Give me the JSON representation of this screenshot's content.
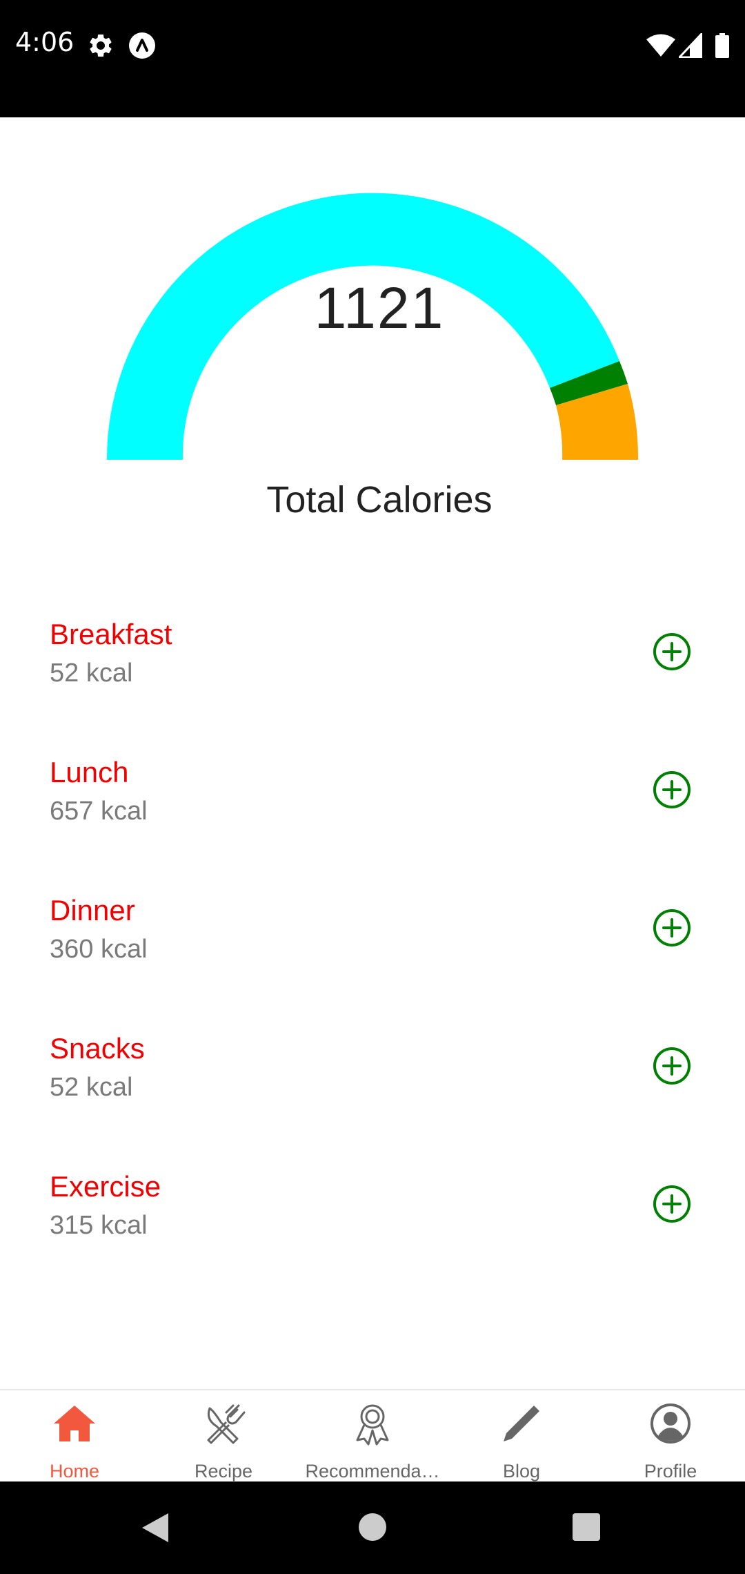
{
  "status_bar": {
    "time": "4:06",
    "icons": [
      "settings-icon",
      "app-notification-icon",
      "wifi-icon",
      "signal-icon",
      "battery-icon"
    ]
  },
  "gauge": {
    "value": "1121",
    "label": "Total Calories",
    "colors": {
      "main": "#00ffff",
      "secondary": "#008000",
      "tertiary": "#ffa500"
    }
  },
  "meals": [
    {
      "name": "Breakfast",
      "kcal": "52 kcal"
    },
    {
      "name": "Lunch",
      "kcal": "657 kcal"
    },
    {
      "name": "Dinner",
      "kcal": "360 kcal"
    },
    {
      "name": "Snacks",
      "kcal": "52 kcal"
    },
    {
      "name": "Exercise",
      "kcal": "315 kcal"
    }
  ],
  "colors": {
    "meal_name": "#f00000",
    "meal_kcal": "#7a7a7a",
    "add_button": "#008000",
    "nav_active": "#f2583e",
    "nav_inactive": "#666666"
  },
  "nav": {
    "items": [
      {
        "label": "Home",
        "icon": "home-icon",
        "active": true
      },
      {
        "label": "Recipe",
        "icon": "utensils-icon",
        "active": false
      },
      {
        "label": "Recommenda…",
        "icon": "award-ribbon-icon",
        "active": false
      },
      {
        "label": "Blog",
        "icon": "pencil-icon",
        "active": false
      },
      {
        "label": "Profile",
        "icon": "user-circle-icon",
        "active": false
      }
    ]
  },
  "system_nav": {
    "icons": [
      "back-icon",
      "home-circle-icon",
      "recents-icon"
    ]
  }
}
